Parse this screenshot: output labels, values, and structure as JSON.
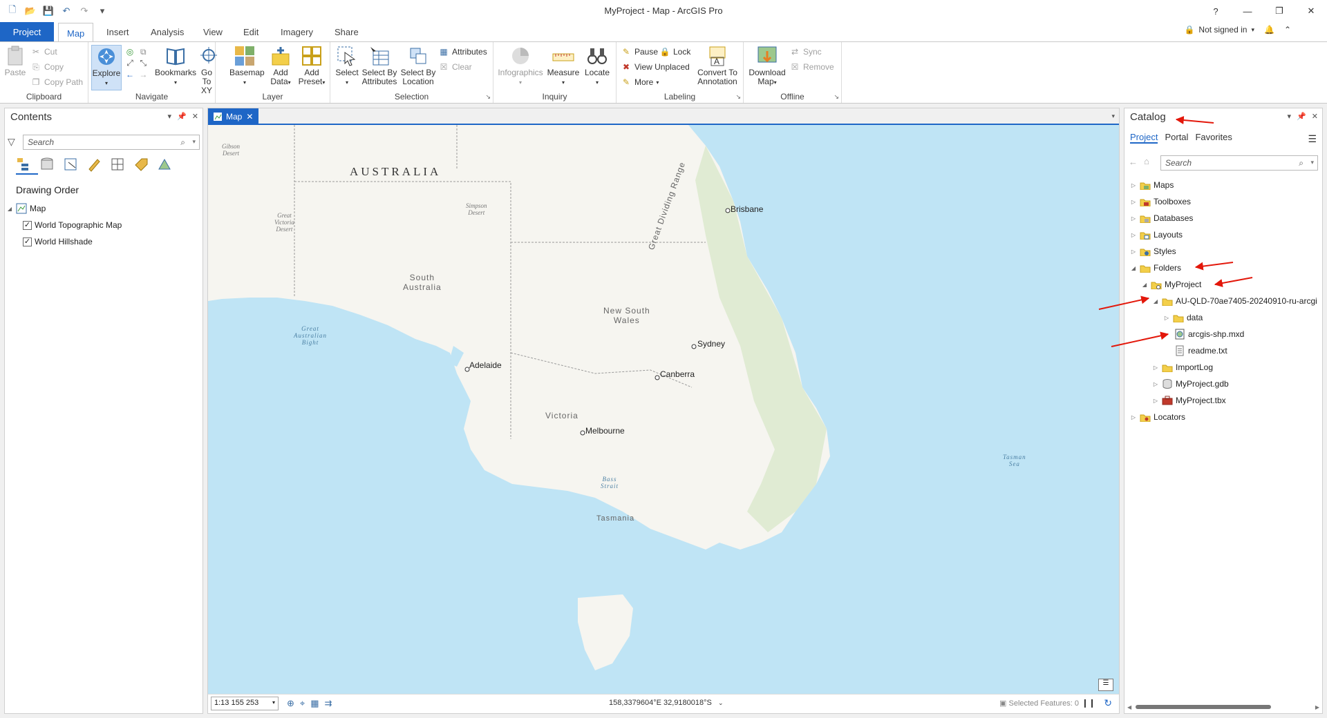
{
  "window": {
    "title": "MyProject - Map - ArcGIS Pro",
    "help": "?"
  },
  "tabs": [
    {
      "label": "Project"
    },
    {
      "label": "Map"
    },
    {
      "label": "Insert"
    },
    {
      "label": "Analysis"
    },
    {
      "label": "View"
    },
    {
      "label": "Edit"
    },
    {
      "label": "Imagery"
    },
    {
      "label": "Share"
    }
  ],
  "signin": "Not signed in",
  "ribbon": {
    "clipboard": {
      "label": "Clipboard",
      "paste": "Paste",
      "cut": "Cut",
      "copy": "Copy",
      "copy_path": "Copy Path"
    },
    "navigate": {
      "label": "Navigate",
      "explore": "Explore",
      "bookmarks": "Bookmarks",
      "goto_1": "Go",
      "goto_2": "To XY"
    },
    "layer": {
      "label": "Layer",
      "basemap": "Basemap",
      "add_data_1": "Add",
      "add_data_2": "Data",
      "add_preset_1": "Add",
      "add_preset_2": "Preset"
    },
    "selection": {
      "label": "Selection",
      "select": "Select",
      "sba_1": "Select By",
      "sba_2": "Attributes",
      "sbl_1": "Select By",
      "sbl_2": "Location",
      "attributes": "Attributes",
      "clear": "Clear"
    },
    "inquiry": {
      "label": "Inquiry",
      "infographics": "Infographics",
      "measure": "Measure",
      "locate": "Locate"
    },
    "labeling": {
      "label": "Labeling",
      "pause": "Pause",
      "lock": "Lock",
      "view_unplaced": "View Unplaced",
      "more": "More",
      "convert_1": "Convert To",
      "convert_2": "Annotation"
    },
    "offline": {
      "label": "Offline",
      "download_1": "Download",
      "download_2": "Map",
      "sync": "Sync",
      "remove": "Remove"
    }
  },
  "contents": {
    "title": "Contents",
    "search_placeholder": "Search",
    "section": "Drawing Order",
    "map_name": "Map",
    "layers": [
      {
        "name": "World Topographic Map",
        "checked": true
      },
      {
        "name": "World Hillshade",
        "checked": true
      }
    ]
  },
  "map": {
    "tab_label": "Map",
    "labels": {
      "australia": "AUSTRALIA",
      "gibson_1": "Gibson",
      "gibson_2": "Desert",
      "gvd_1": "Great",
      "gvd_2": "Victoria",
      "gvd_3": "Desert",
      "simpson_1": "Simpson",
      "simpson_2": "Desert",
      "sa_1": "South",
      "sa_2": "Australia",
      "gab_1": "Great",
      "gab_2": "Australian",
      "gab_3": "Bight",
      "adelaide": "Adelaide",
      "nsw_1": "New South",
      "nsw_2": "Wales",
      "gdr": "Great Dividing Range",
      "brisbane": "Brisbane",
      "sydney": "Sydney",
      "canberra": "Canberra",
      "victoria": "Victoria",
      "melbourne": "Melbourne",
      "bass_1": "Bass",
      "bass_2": "Strait",
      "tasmania": "Tasmania",
      "tasman_1": "Tasman",
      "tasman_2": "Sea"
    },
    "scale": "1:13 155 253",
    "coords": "158,3379604°E 32,9180018°S",
    "selected_features": "Selected Features: 0"
  },
  "catalog": {
    "title": "Catalog",
    "tabs": [
      "Project",
      "Portal",
      "Favorites"
    ],
    "search_placeholder": "Search",
    "items": {
      "maps": "Maps",
      "toolboxes": "Toolboxes",
      "databases": "Databases",
      "layouts": "Layouts",
      "styles": "Styles",
      "folders": "Folders",
      "myproject": "MyProject",
      "au_folder": "AU-QLD-70ae7405-20240910-ru-arcgi",
      "data": "data",
      "mxd": "arcgis-shp.mxd",
      "readme": "readme.txt",
      "importlog": "ImportLog",
      "gdb": "MyProject.gdb",
      "tbx": "MyProject.tbx",
      "locators": "Locators"
    }
  },
  "colors": {
    "accent": "#1e66c6",
    "water": "#bfe4f5",
    "land": "#f6f5f0",
    "annotation": "#e3170a"
  }
}
